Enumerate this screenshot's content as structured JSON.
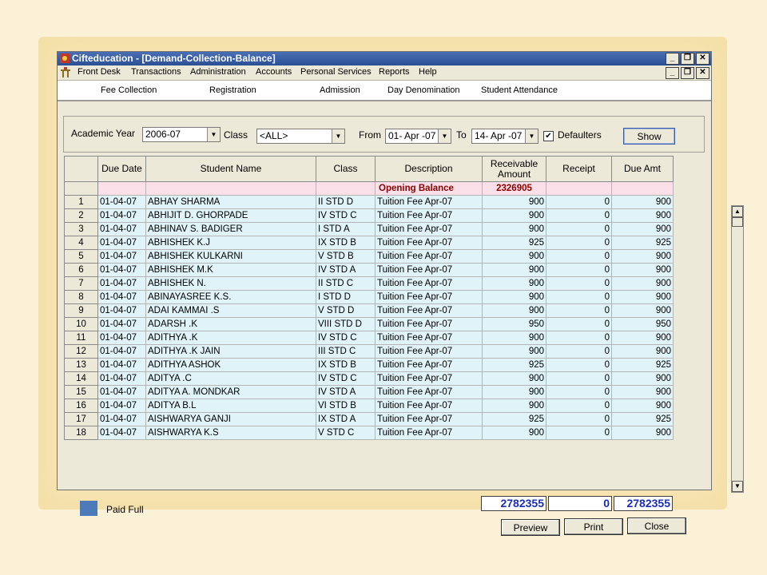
{
  "window": {
    "title": "Cifteducation - [Demand-Collection-Balance]"
  },
  "menu": [
    "Front Desk",
    "Transactions",
    "Administration",
    "Accounts",
    "Personal Services",
    "Reports",
    "Help"
  ],
  "toolbar": [
    "Fee Collection",
    "Registration",
    "Admission",
    "Day Denomination",
    "Student Attendance"
  ],
  "filters": {
    "academic_year_label": "Academic Year",
    "academic_year": "2006-07",
    "class_label": "Class",
    "class_value": "<ALL>",
    "from_label": "From",
    "from_date": "01- Apr -07",
    "to_label": "To",
    "to_date": "14- Apr -07",
    "defaulters_label": "Defaulters",
    "defaulters_checked": "✔",
    "show_button": "Show"
  },
  "grid": {
    "columns": [
      "Due Date",
      "Student Name",
      "Class",
      "Description",
      "Receivable Amount",
      "Receipt",
      "Due Amt"
    ],
    "opening_balance": {
      "label": "Opening Balance",
      "amount": "2326905"
    },
    "rows": [
      [
        "1",
        "01-04-07",
        "ABHAY SHARMA",
        "II STD D",
        "Tuition Fee Apr-07",
        "900",
        "0",
        "900"
      ],
      [
        "2",
        "01-04-07",
        "ABHIJIT D. GHORPADE",
        "IV STD C",
        "Tuition Fee Apr-07",
        "900",
        "0",
        "900"
      ],
      [
        "3",
        "01-04-07",
        "ABHINAV S. BADIGER",
        "I STD A",
        "Tuition Fee Apr-07",
        "900",
        "0",
        "900"
      ],
      [
        "4",
        "01-04-07",
        "ABHISHEK K.J",
        "IX STD B",
        "Tuition Fee Apr-07",
        "925",
        "0",
        "925"
      ],
      [
        "5",
        "01-04-07",
        "ABHISHEK KULKARNI",
        "V STD B",
        "Tuition Fee Apr-07",
        "900",
        "0",
        "900"
      ],
      [
        "6",
        "01-04-07",
        "ABHISHEK M.K",
        "IV STD A",
        "Tuition Fee Apr-07",
        "900",
        "0",
        "900"
      ],
      [
        "7",
        "01-04-07",
        "ABHISHEK N.",
        "II STD C",
        "Tuition Fee Apr-07",
        "900",
        "0",
        "900"
      ],
      [
        "8",
        "01-04-07",
        "ABINAYASREE K.S.",
        "I STD D",
        "Tuition Fee Apr-07",
        "900",
        "0",
        "900"
      ],
      [
        "9",
        "01-04-07",
        "ADAI KAMMAI .S",
        "V STD D",
        "Tuition Fee Apr-07",
        "900",
        "0",
        "900"
      ],
      [
        "10",
        "01-04-07",
        "ADARSH .K",
        "VIII STD D",
        "Tuition Fee Apr-07",
        "950",
        "0",
        "950"
      ],
      [
        "11",
        "01-04-07",
        "ADITHYA .K",
        "IV STD C",
        "Tuition Fee Apr-07",
        "900",
        "0",
        "900"
      ],
      [
        "12",
        "01-04-07",
        "ADITHYA .K JAIN",
        "III STD C",
        "Tuition Fee Apr-07",
        "900",
        "0",
        "900"
      ],
      [
        "13",
        "01-04-07",
        "ADITHYA ASHOK",
        "IX STD B",
        "Tuition Fee Apr-07",
        "925",
        "0",
        "925"
      ],
      [
        "14",
        "01-04-07",
        "ADITYA .C",
        "IV STD C",
        "Tuition Fee Apr-07",
        "900",
        "0",
        "900"
      ],
      [
        "15",
        "01-04-07",
        "ADITYA A. MONDKAR",
        "IV STD A",
        "Tuition Fee Apr-07",
        "900",
        "0",
        "900"
      ],
      [
        "16",
        "01-04-07",
        "ADITYA B.L",
        "VI STD B",
        "Tuition Fee Apr-07",
        "900",
        "0",
        "900"
      ],
      [
        "17",
        "01-04-07",
        "AISHWARYA GANJI",
        "IX STD A",
        "Tuition Fee Apr-07",
        "925",
        "0",
        "925"
      ],
      [
        "18",
        "01-04-07",
        "AISHWARYA K.S",
        "V STD C",
        "Tuition Fee Apr-07",
        "900",
        "0",
        "900"
      ]
    ]
  },
  "totals": {
    "receivable": "2782355",
    "receipt": "0",
    "due": "2782355"
  },
  "legend": {
    "label": "Paid Full",
    "color": "#4d7ab8"
  },
  "buttons": {
    "preview": "Preview",
    "print": "Print",
    "close": "Close"
  }
}
